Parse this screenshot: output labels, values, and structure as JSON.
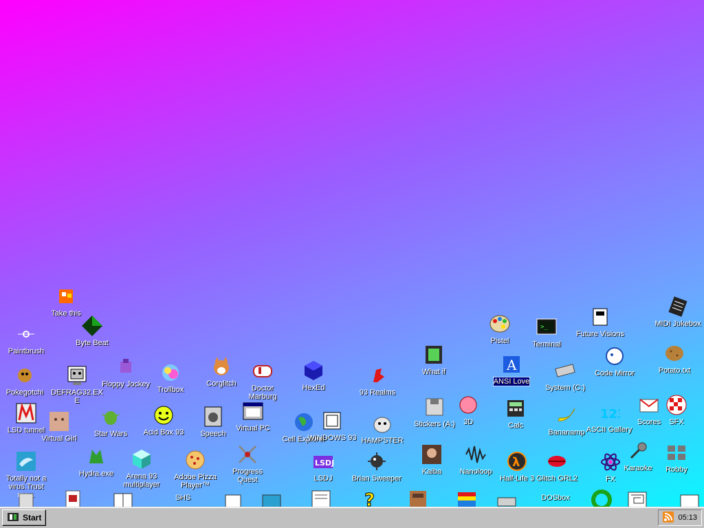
{
  "icons": [
    {
      "id": "take-this",
      "label": "Take this"
    },
    {
      "id": "byte-beat",
      "label": "Byte Beat"
    },
    {
      "id": "paintbrush",
      "label": "Paintbrush"
    },
    {
      "id": "pokegotchi",
      "label": "Pokegotchi"
    },
    {
      "id": "defrag32",
      "label": "DEFRAG32.EXE"
    },
    {
      "id": "floppy-jockey",
      "label": "Floppy Jockey"
    },
    {
      "id": "trollbox",
      "label": "Trollbox"
    },
    {
      "id": "corglitch",
      "label": "Corglitch"
    },
    {
      "id": "doctor-marburg",
      "label": "Doctor Marburg"
    },
    {
      "id": "hexed",
      "label": "HexEd"
    },
    {
      "id": "93-realms",
      "label": "93 Realms"
    },
    {
      "id": "what-if",
      "label": "What if"
    },
    {
      "id": "pistel",
      "label": "Pistel"
    },
    {
      "id": "terminal",
      "label": "Terminal"
    },
    {
      "id": "future-visions",
      "label": "Future Visions"
    },
    {
      "id": "midi-jukebox",
      "label": "MIDI Jukebox"
    },
    {
      "id": "code-mirror",
      "label": "Code Mirror"
    },
    {
      "id": "potato",
      "label": "Potato.txt"
    },
    {
      "id": "ansi-love",
      "label": "ANSI Love",
      "selected": true
    },
    {
      "id": "system-c",
      "label": "System (C:)"
    },
    {
      "id": "lsd-tunnel",
      "label": "LSD tunnel"
    },
    {
      "id": "virtual-girl",
      "label": "Virtual Girl"
    },
    {
      "id": "star-wars",
      "label": "Star Wars"
    },
    {
      "id": "acid-box",
      "label": "Acid Box 93"
    },
    {
      "id": "speech",
      "label": "Speech"
    },
    {
      "id": "virtual-pc",
      "label": "Virtual PC"
    },
    {
      "id": "cell-explorer",
      "label": "Cell Explorer"
    },
    {
      "id": "windows-93",
      "label": "WINDOWS 93"
    },
    {
      "id": "hampster",
      "label": "HAMPSTER"
    },
    {
      "id": "stickers",
      "label": "Stickers (A:)"
    },
    {
      "id": "3d",
      "label": "3D"
    },
    {
      "id": "calc",
      "label": "Calc"
    },
    {
      "id": "bananamp",
      "label": "Bananamp"
    },
    {
      "id": "ascii-gallery",
      "label": "ASCII Gallery"
    },
    {
      "id": "scores",
      "label": "Scores"
    },
    {
      "id": "sfx",
      "label": "SFX"
    },
    {
      "id": "totally-not-virus",
      "label": "Totally not a virus.Trust me..."
    },
    {
      "id": "hydra",
      "label": "Hydra.exe"
    },
    {
      "id": "arena-93",
      "label": "Arena 93 multiplayer"
    },
    {
      "id": "adobe-pizza",
      "label": "Adobe Pizza Player™"
    },
    {
      "id": "progress-quest",
      "label": "Progress Quest"
    },
    {
      "id": "lsdj",
      "label": "LSDJ"
    },
    {
      "id": "brian-sweeper",
      "label": "Brian Sweeper"
    },
    {
      "id": "kaiba",
      "label": "Kaiba"
    },
    {
      "id": "nanoloop",
      "label": "Nanoloop"
    },
    {
      "id": "half-life",
      "label": "Half-Life 3"
    },
    {
      "id": "glitch-grl",
      "label": "Glitch GRL2"
    },
    {
      "id": "fx",
      "label": "FX"
    },
    {
      "id": "karaoke",
      "label": "Karaoke"
    },
    {
      "id": "robby",
      "label": "Robby"
    },
    {
      "id": "shs",
      "label": "SHS"
    },
    {
      "id": "dosbox",
      "label": "DOSbox"
    }
  ],
  "taskbar": {
    "start_label": "Start",
    "clock": "05:13"
  }
}
